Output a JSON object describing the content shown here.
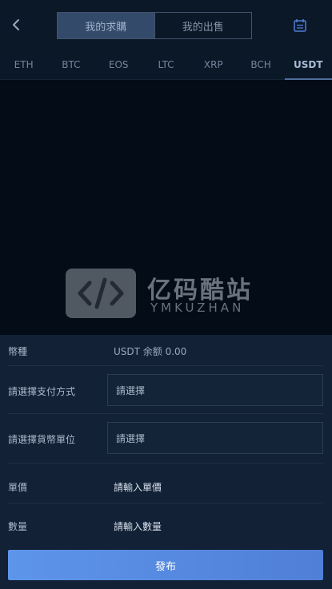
{
  "header": {
    "tabs": [
      {
        "label": "我的求購",
        "active": true
      },
      {
        "label": "我的出售",
        "active": false
      }
    ],
    "back_icon": "chevron-left-icon",
    "calendar_icon": "calendar-icon"
  },
  "coins": [
    "ETH",
    "BTC",
    "EOS",
    "LTC",
    "XRP",
    "BCH",
    "USDT"
  ],
  "active_coin": "USDT",
  "watermark": {
    "cn": "亿码酷站",
    "en": "YMKUZHAN"
  },
  "form": {
    "currency_label": "幣種",
    "currency_value": "USDT 余额 0.00",
    "payment_label": "請選擇支付方式",
    "payment_placeholder": "請選擇",
    "unit_label": "請選擇貨幣單位",
    "unit_placeholder": "請選擇",
    "price_label": "單價",
    "price_placeholder": "請輸入單價",
    "qty_label": "數量",
    "qty_placeholder": "請輸入數量"
  },
  "submit_label": "發布",
  "colors": {
    "accent": "#5d95ea",
    "background": "#030c17",
    "panel": "#122136"
  }
}
